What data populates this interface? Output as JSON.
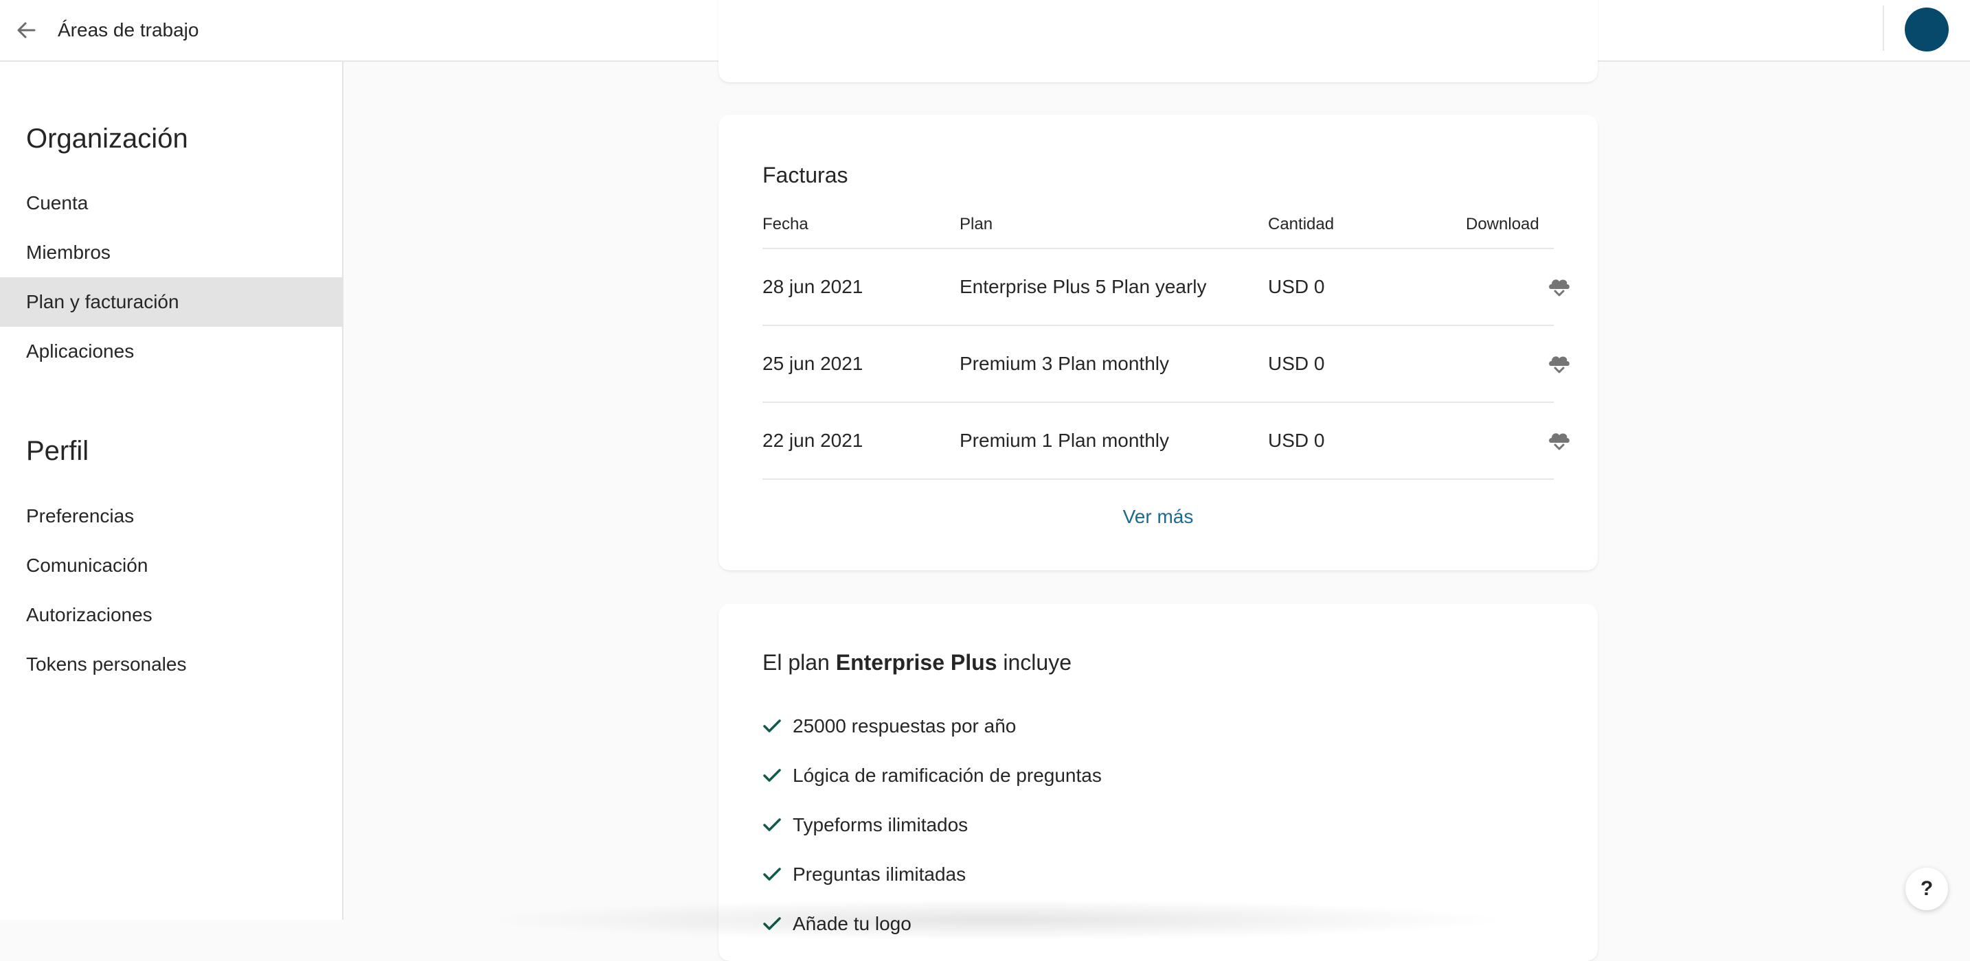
{
  "topbar": {
    "title": "Áreas de trabajo",
    "back_icon": "arrow-left-icon"
  },
  "sidebar": {
    "org_heading": "Organización",
    "org_items": [
      "Cuenta",
      "Miembros",
      "Plan y facturación",
      "Aplicaciones"
    ],
    "active_item": "Plan y facturación",
    "profile_heading": "Perfil",
    "profile_items": [
      "Preferencias",
      "Comunicación",
      "Autorizaciones",
      "Tokens personales"
    ]
  },
  "invoices": {
    "title": "Facturas",
    "columns": {
      "date": "Fecha",
      "plan": "Plan",
      "amount": "Cantidad",
      "download": "Download"
    },
    "rows": [
      {
        "date": "28 jun 2021",
        "plan": "Enterprise Plus 5 Plan yearly",
        "amount": "USD 0"
      },
      {
        "date": "25 jun 2021",
        "plan": "Premium 3 Plan monthly",
        "amount": "USD 0"
      },
      {
        "date": "22 jun 2021",
        "plan": "Premium 1 Plan monthly",
        "amount": "USD 0"
      }
    ],
    "more_label": "Ver más",
    "download_icon": "cloud-download-icon"
  },
  "plan": {
    "title_prefix": "El plan ",
    "plan_name": "Enterprise Plus",
    "title_suffix": " incluye",
    "features": [
      "25000 respuestas por año",
      "Lógica de ramificación de preguntas",
      "Typeforms ilimitados",
      "Preguntas ilimitadas",
      "Añade tu logo"
    ]
  },
  "help": {
    "label": "?"
  },
  "colors": {
    "accent": "#1a6a91",
    "avatar": "#07496b",
    "check": "#0f5a4a",
    "active_nav": "#e3e3e3"
  }
}
